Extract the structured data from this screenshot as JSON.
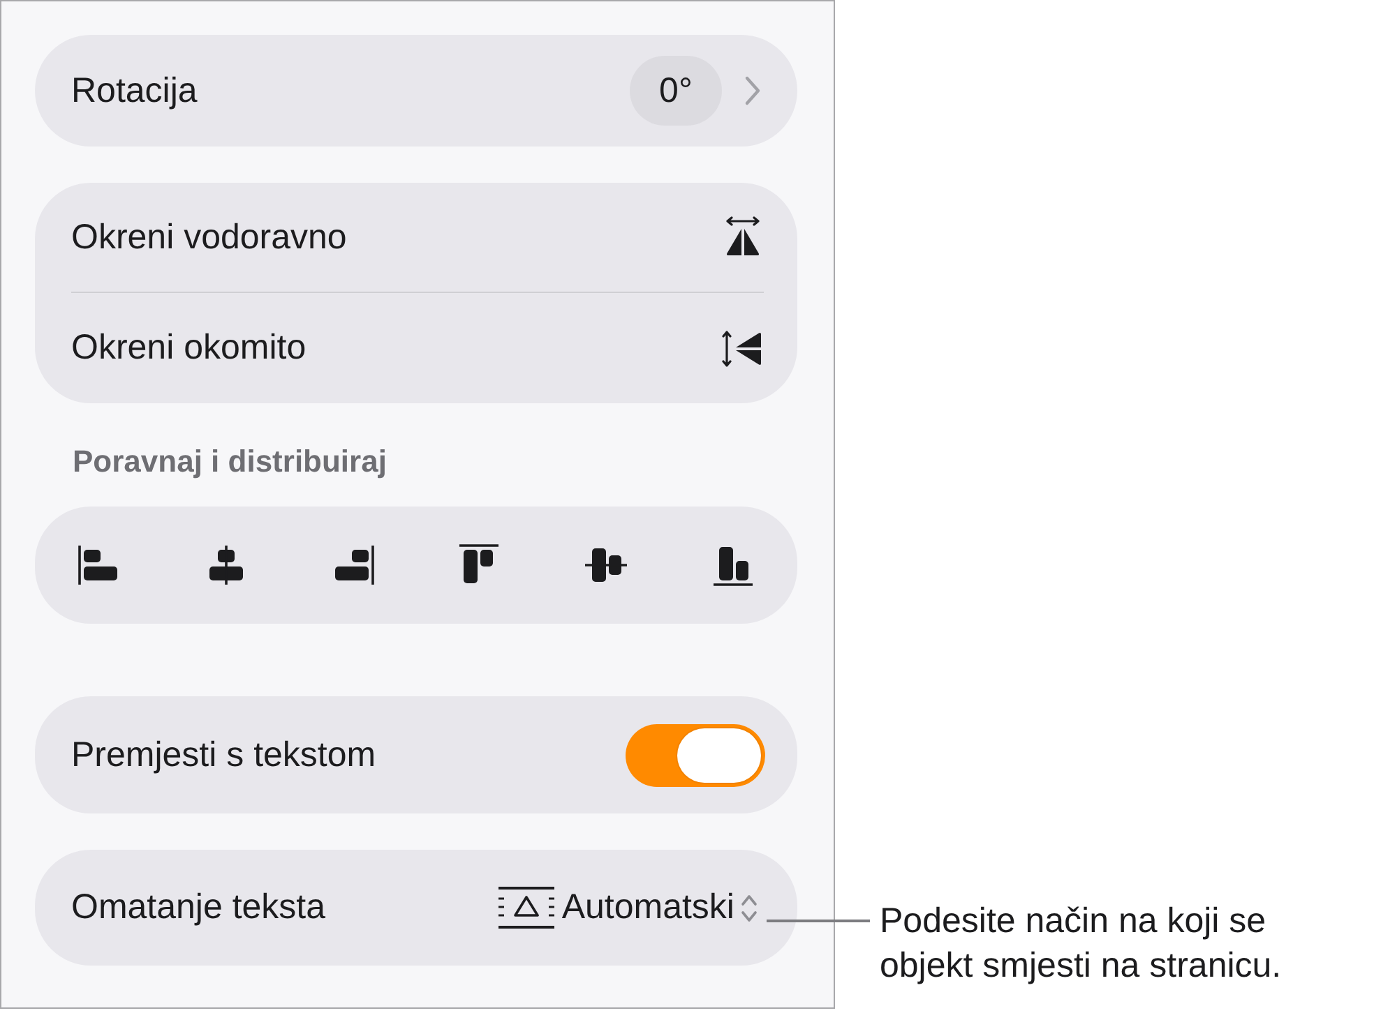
{
  "rotation": {
    "label": "Rotacija",
    "value": "0°"
  },
  "flip": [
    {
      "label": "Okreni vodoravno",
      "kind": "horizontal"
    },
    {
      "label": "Okreni okomito",
      "kind": "vertical"
    }
  ],
  "align": {
    "title": "Poravnaj i distribuiraj",
    "buttons": [
      {
        "kind": "left"
      },
      {
        "kind": "center"
      },
      {
        "kind": "right"
      },
      {
        "kind": "top"
      },
      {
        "kind": "middle"
      },
      {
        "kind": "bottom"
      }
    ]
  },
  "move_with_text": {
    "label": "Premjesti s tekstom",
    "on": true
  },
  "text_wrap": {
    "label": "Omatanje teksta",
    "value": "Automatski"
  },
  "callout": {
    "text": "Podesite način na koji se objekt smjesti na stranicu."
  }
}
